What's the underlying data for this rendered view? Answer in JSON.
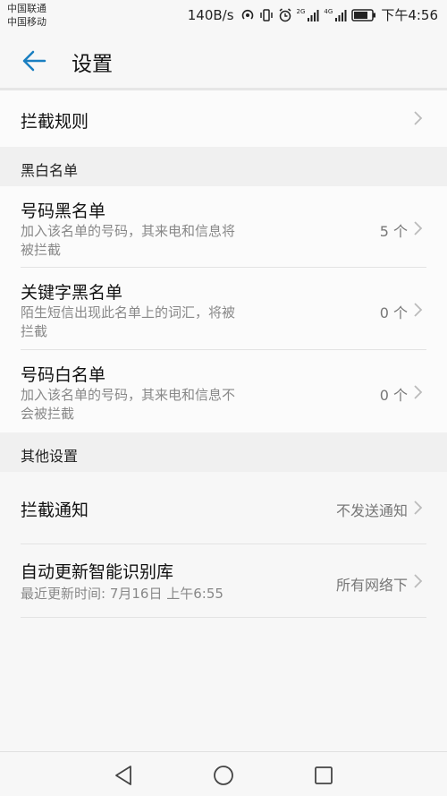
{
  "status_bar": {
    "carrier_1": "中国联通",
    "carrier_2": "中国移动",
    "net_speed": "140B/s",
    "net_tag_1": "2G",
    "net_tag_2": "4G",
    "time": "下午4:56"
  },
  "app_bar": {
    "title": "设置"
  },
  "intercept_rules": {
    "label": "拦截规则"
  },
  "blackwhite_section": {
    "header": "黑白名单",
    "items": [
      {
        "title": "号码黑名单",
        "subtitle_line1": "加入该名单的号码，其来电和信息将",
        "subtitle_line2": "被拦截",
        "value": "5 个"
      },
      {
        "title": "关键字黑名单",
        "subtitle_line1": "陌生短信出现此名单上的词汇，将被",
        "subtitle_line2": "拦截",
        "value": "0 个"
      },
      {
        "title": "号码白名单",
        "subtitle_line1": "加入该名单的号码，其来电和信息不",
        "subtitle_line2": "会被拦截",
        "value": "0 个"
      }
    ]
  },
  "other_section": {
    "header": "其他设置",
    "items": [
      {
        "title": "拦截通知",
        "value": "不发送通知"
      },
      {
        "title": "自动更新智能识别库",
        "subtitle": "最近更新时间: 7月16日 上午6:55",
        "value": "所有网络下"
      }
    ]
  },
  "colors": {
    "accent": "#1a7fc1",
    "background": "#f7f7f7",
    "section_bg": "#f0f0f0"
  }
}
